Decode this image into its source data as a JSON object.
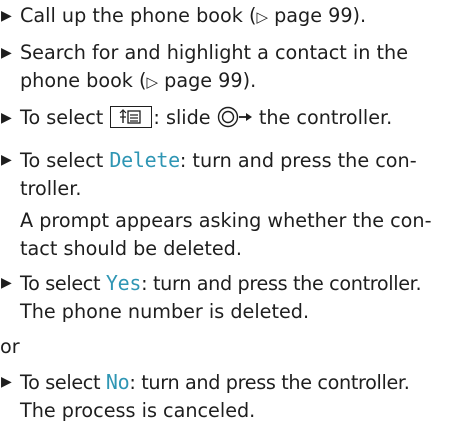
{
  "steps": [
    {
      "text_before": "Call up the phone book (",
      "arrow": "▷",
      "text_after": " page 99)."
    },
    {
      "line1": "Search for and highlight a contact in the",
      "line2_before": "phone book (",
      "arrow": "▷",
      "line2_after": " page 99)."
    },
    {
      "text_before": "To select ",
      "text_middle": ": slide ",
      "text_after": " the controller.",
      "menu_icon": "phone-book-menu-icon",
      "controller_icon": "controller-slide-right-icon"
    },
    {
      "text_before": "To select ",
      "highlight": "Delete",
      "line1_after": ": turn and press the con-",
      "line2": "troller.",
      "result_line1": "A prompt appears asking whether the con-",
      "result_line2": "tact should be deleted."
    },
    {
      "text_before": "To select ",
      "highlight": "Yes",
      "text_after": ": turn and press the controller.",
      "result": "The phone number is deleted."
    }
  ],
  "or_label": "or",
  "alt_step": {
    "text_before": "To select ",
    "highlight": "No",
    "text_after": ": turn and press the controller.",
    "result": "The process is canceled."
  },
  "colors": {
    "text": "#1e1e1e",
    "highlight": "#2f96b4"
  },
  "bullet_glyph": "▶"
}
